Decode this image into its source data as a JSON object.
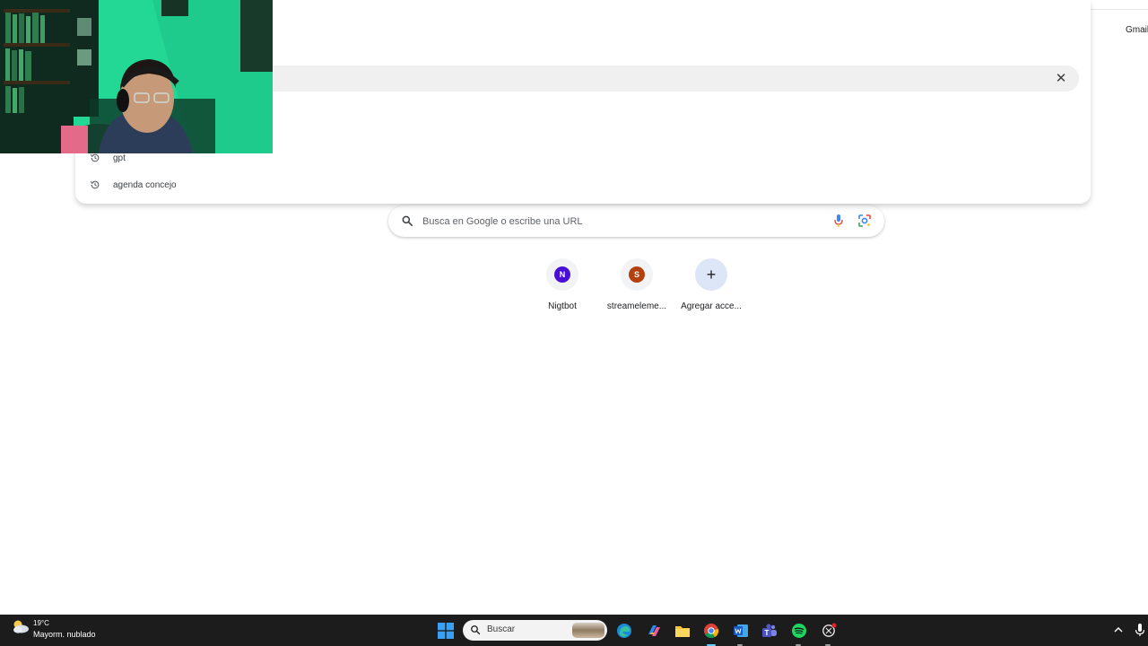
{
  "header": {
    "gmail_label": "Gmail"
  },
  "omnibox": {
    "clear_icon": "close-icon",
    "suggestions": [
      {
        "icon": "history-icon",
        "label": "gpt"
      },
      {
        "icon": "history-icon",
        "label": "agenda concejo"
      }
    ]
  },
  "ntp": {
    "search_placeholder": "Busca en Google o escribe una URL",
    "shortcuts": [
      {
        "letter": "N",
        "name": "Nigtbot",
        "color": "#4a0fd6"
      },
      {
        "letter": "S",
        "name": "streameleme...",
        "color": "#b3410e"
      },
      {
        "letter": "+",
        "name": "Agregar acce..."
      }
    ]
  },
  "taskbar": {
    "weather_temp": "19°C",
    "weather_condition": "Mayorm. nublado",
    "search_label": "Buscar",
    "apps": [
      "start-icon",
      "edge-icon",
      "copilot-icon",
      "file-explorer-icon",
      "chrome-icon",
      "word-icon",
      "teams-icon",
      "spotify-icon",
      "chatgpt-icon"
    ]
  },
  "colors": {
    "accent": "#1a73e8",
    "taskbar": "#1c1c1c",
    "webcam_bg": "#21d592"
  }
}
